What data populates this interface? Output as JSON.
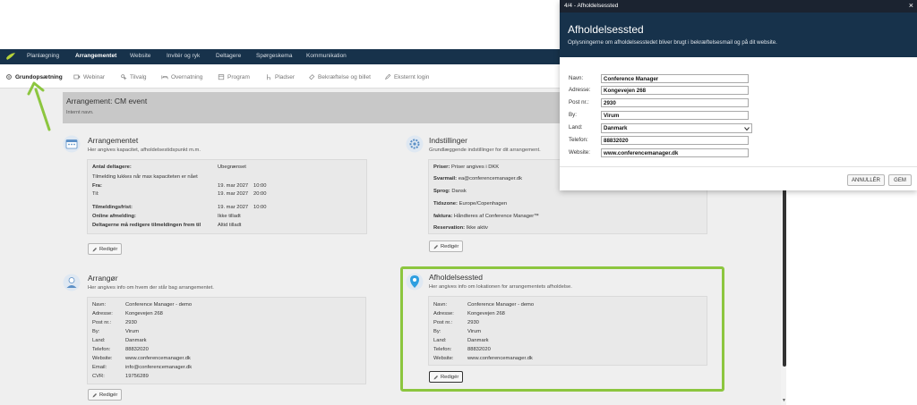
{
  "topnav": {
    "items": [
      "Planlægning",
      "Arrangementet",
      "Website",
      "Invitér og ryk",
      "Deltagere",
      "Spørgeskema",
      "Kommunikation"
    ],
    "active": "Arrangementet"
  },
  "subnav": {
    "items": [
      "Grundopsætning",
      "Webinar",
      "Tilvalg",
      "Overnatning",
      "Program",
      "Pladser",
      "Bekræftelse og billet",
      "Eksternt login"
    ],
    "active": "Grundopsætning"
  },
  "arrangement_header": {
    "title": "Arrangement: CM event",
    "subtitle": "Internt navn."
  },
  "edit_label": "Redigér",
  "arrangementet": {
    "title": "Arrangementet",
    "desc": "Her angives kapacitet, afholdelsestidspunkt m.m.",
    "rows": [
      {
        "label": "Antal deltagere:",
        "value": "Ubegrænset"
      },
      {
        "label": "Tilmelding lukkes når max kapaciteten er nået",
        "value": ""
      },
      {
        "label": "Fra:",
        "value": "19. mar 2027",
        "time": "10:00"
      },
      {
        "label": "Til:",
        "value": "19. mar 2027",
        "time": "20:00"
      },
      {
        "label": "Tilmeldingsfrist:",
        "value": "19. mar 2027",
        "time": "10:00"
      },
      {
        "label": "Online afmelding:",
        "value": "Ikke tilladt"
      },
      {
        "label": "Deltagerne må redigere tilmeldingen frem til",
        "value": "Altid tilladt"
      }
    ]
  },
  "indstillinger": {
    "title": "Indstillinger",
    "desc": "Grundlæggende indstillinger for dit arrangement.",
    "rows": [
      {
        "label": "Priser:",
        "value": "Priser angives i DKK"
      },
      {
        "label": "Svarmail:",
        "value": "ea@conferencemanager.dk"
      },
      {
        "label": "Sprog:",
        "value": "Dansk"
      },
      {
        "label": "Tidszone:",
        "value": "Europe/Copenhagen"
      },
      {
        "label": "faktura:",
        "value": "Håndteres af Conference Manager™"
      },
      {
        "label": "Reservation:",
        "value": "Ikke aktiv"
      }
    ]
  },
  "arrangor": {
    "title": "Arrangør",
    "desc": "Her angives info om hvem der står bag arrangementet.",
    "rows": [
      {
        "label": "Navn:",
        "value": "Conference Manager - demo"
      },
      {
        "label": "Adresse:",
        "value": "Kongevejen 268"
      },
      {
        "label": "Post nr.:",
        "value": "2930"
      },
      {
        "label": "By:",
        "value": "Virum"
      },
      {
        "label": "Land:",
        "value": "Danmark"
      },
      {
        "label": "Telefon:",
        "value": "88832020"
      },
      {
        "label": "Website:",
        "value": "www.conferencemanager.dk"
      },
      {
        "label": "Email:",
        "value": "info@conferencemanager.dk"
      },
      {
        "label": "CVR:",
        "value": "19756289"
      }
    ]
  },
  "afholdelsessted": {
    "title": "Afholdelsessted",
    "desc": "Her angives info om lokationen for arrangementets afholdelse.",
    "rows": [
      {
        "label": "Navn:",
        "value": "Conference Manager - demo"
      },
      {
        "label": "Adresse:",
        "value": "Kongevejen 268"
      },
      {
        "label": "Post nr.:",
        "value": "2930"
      },
      {
        "label": "By:",
        "value": "Virum"
      },
      {
        "label": "Land:",
        "value": "Danmark"
      },
      {
        "label": "Telefon:",
        "value": "88832020"
      },
      {
        "label": "Website:",
        "value": "www.conferencemanager.dk"
      }
    ]
  },
  "modal": {
    "titlebar": "4/4 - Afholdelsessted",
    "close": "×",
    "heading": "Afholdelsessted",
    "description": "Oplysningerne om afholdelsesstedet bliver brugt i bekræftelsesmail og på dit website.",
    "fields": [
      {
        "label": "Navn:",
        "value": "Conference Manager"
      },
      {
        "label": "Adresse:",
        "value": "Kongevejen 268"
      },
      {
        "label": "Post nr.:",
        "value": "2930"
      },
      {
        "label": "By:",
        "value": "Virum"
      },
      {
        "label": "Land:",
        "value": "Danmark",
        "type": "select"
      },
      {
        "label": "Telefon:",
        "value": "88832020"
      },
      {
        "label": "Website:",
        "value": "www.conferencemanager.dk"
      }
    ],
    "cancel": "ANNULLÉR",
    "save": "GEM"
  },
  "colors": {
    "nav_dark": "#17324b",
    "highlight_green": "#8cc63f",
    "modal_titlebar": "#1b2330"
  }
}
